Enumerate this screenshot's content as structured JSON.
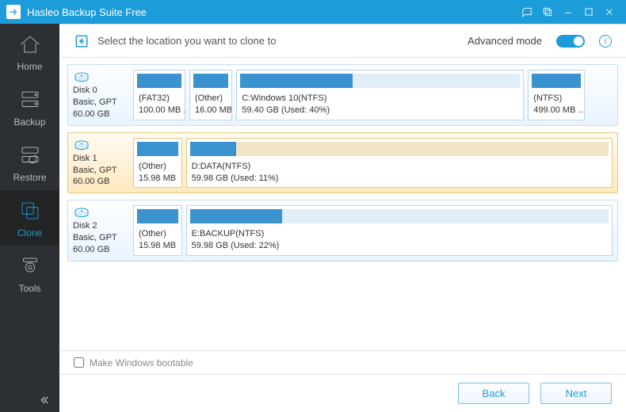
{
  "app": {
    "title": "Hasleo Backup Suite Free"
  },
  "sidebar": {
    "items": [
      {
        "label": "Home"
      },
      {
        "label": "Backup"
      },
      {
        "label": "Restore"
      },
      {
        "label": "Clone"
      },
      {
        "label": "Tools"
      }
    ]
  },
  "header": {
    "prompt": "Select the location you want to clone to",
    "advanced_label": "Advanced mode"
  },
  "disks": [
    {
      "selected": false,
      "label_name": "Disk 0",
      "label_type": "Basic, GPT",
      "label_size": "60.00 GB",
      "parts": [
        {
          "title": "(FAT32)",
          "sub": "100.00 MB ...",
          "fill": 100,
          "flex": 0.11
        },
        {
          "title": "(Other)",
          "sub": "16.00 MB ...",
          "fill": 100,
          "flex": 0.09
        },
        {
          "title": "C:Windows 10(NTFS)",
          "sub": "59.40 GB (Used: 40%)",
          "fill": 40,
          "flex": 0.62
        },
        {
          "title": "(NTFS)",
          "sub": "499.00 MB ...",
          "fill": 100,
          "flex": 0.12
        }
      ]
    },
    {
      "selected": true,
      "label_name": "Disk 1",
      "label_type": "Basic, GPT",
      "label_size": "60.00 GB",
      "parts": [
        {
          "title": "(Other)",
          "sub": "15.98 MB",
          "fill": 100,
          "flex": 0.1
        },
        {
          "title": "D:DATA(NTFS)",
          "sub": "59.98 GB (Used: 11%)",
          "fill": 11,
          "flex": 0.9
        }
      ]
    },
    {
      "selected": false,
      "label_name": "Disk 2",
      "label_type": "Basic, GPT",
      "label_size": "60.00 GB",
      "parts": [
        {
          "title": "(Other)",
          "sub": "15.98 MB",
          "fill": 100,
          "flex": 0.1
        },
        {
          "title": "E:BACKUP(NTFS)",
          "sub": "59.98 GB (Used: 22%)",
          "fill": 22,
          "flex": 0.9
        }
      ]
    }
  ],
  "footer": {
    "bootable_label": "Make Windows bootable",
    "back_label": "Back",
    "next_label": "Next"
  }
}
